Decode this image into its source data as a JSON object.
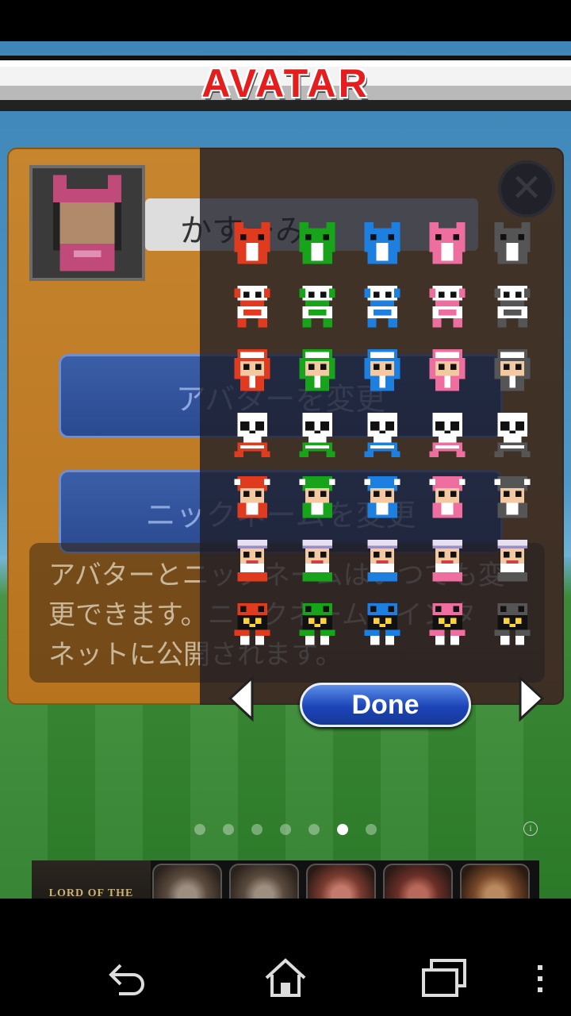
{
  "screen": {
    "title": "AVATAR"
  },
  "profile": {
    "nickname": "かすーみ",
    "change_avatar_label": "アバターを変更",
    "change_nickname_label": "ニックネームを変更",
    "info_text": [
      "アバターとニックネームはいつでも変",
      "更できます。ニックネームはインタ",
      "ネットに公開されます。"
    ]
  },
  "picker": {
    "done_label": "Done",
    "rows": 7,
    "columns": 5,
    "color_variants": [
      "#e03b1f",
      "#17a31a",
      "#1d7fe0",
      "#ee6f9f",
      "#555555"
    ]
  },
  "pager": {
    "total": 7,
    "active_index": 5
  },
  "ad": {
    "brand": "LORD OF THE DRAGONS"
  },
  "colors": {
    "title_red": "#e51d1d",
    "panel_orange": "#c7852e",
    "button_blue": "#3b5ea8"
  }
}
